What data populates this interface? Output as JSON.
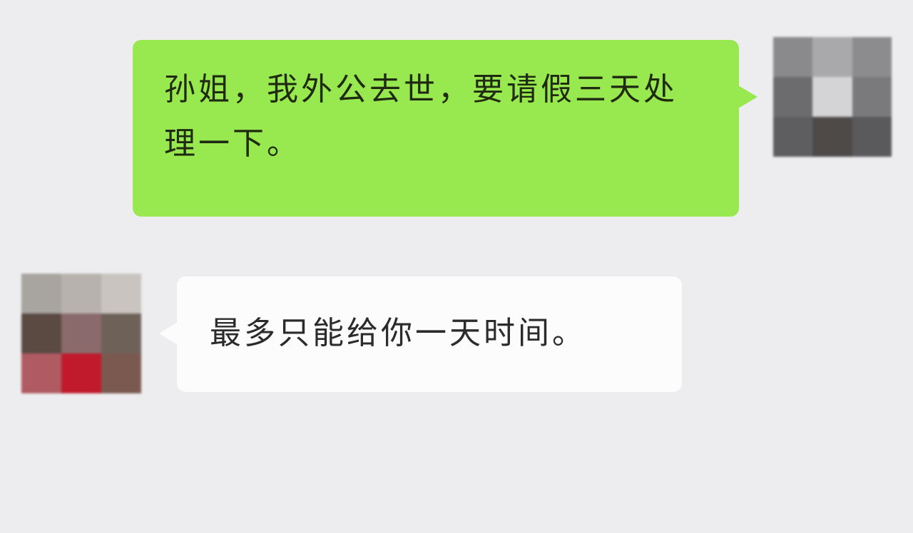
{
  "messages": [
    {
      "id": "msg-1",
      "direction": "sent",
      "text": "孙姐，我外公去世，要请假三天处理一下。",
      "bubble_color": "#98e84f"
    },
    {
      "id": "msg-2",
      "direction": "received",
      "text": "最多只能给你一天时间。",
      "bubble_color": "#fcfcfd"
    }
  ],
  "avatars": {
    "self": {
      "style": "pixelated-mosaic",
      "colors": [
        "#8a8a8c",
        "#a9a9ab",
        "#8c8c8e",
        "#6c6c6e",
        "#d4d4d6",
        "#7a7a7c",
        "#5e5e60",
        "#4d4a48",
        "#5a5a5c"
      ]
    },
    "other": {
      "style": "pixelated-mosaic",
      "colors": [
        "#a8a4a0",
        "#b8b2ae",
        "#c9c4c0",
        "#5a4a42",
        "#8a6a6a",
        "#6e6258",
        "#b05a62",
        "#c01a2c",
        "#7a5a50"
      ]
    }
  },
  "theme": {
    "background": "#ededef",
    "sent_bubble": "#98e84f",
    "received_bubble": "#fcfcfd"
  }
}
